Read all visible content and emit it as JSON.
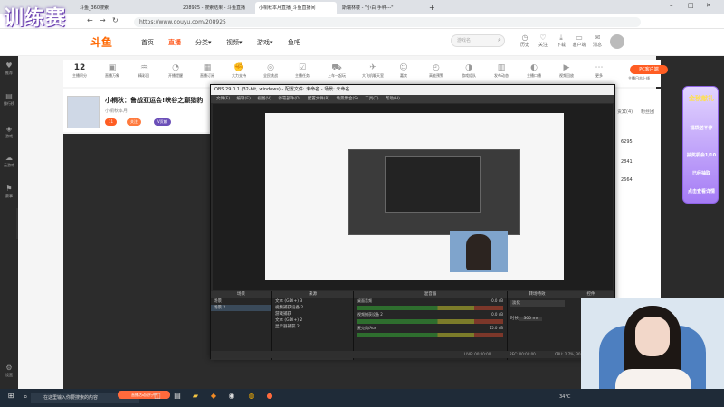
{
  "browser": {
    "tabs": [
      {
        "label": "斗鱼_360搜索",
        "active": false
      },
      {
        "label": "208925 - 搜索结果 - 斗鱼直播",
        "active": false
      },
      {
        "label": "小桐秋本月直播_斗鱼直播间",
        "active": true
      },
      {
        "label": "斯瑞林楼 - \"小白 手秤---\"",
        "active": false
      }
    ],
    "new_tab_label": "+",
    "url": "https://www.douyu.com/208925",
    "window_controls": [
      "–",
      "□",
      "✕"
    ]
  },
  "watermark": "训练赛",
  "douyu": {
    "logo": "斗鱼",
    "nav": [
      {
        "label": "首页",
        "active": false
      },
      {
        "label": "直播",
        "active": true
      },
      {
        "label": "分类▾",
        "active": false
      },
      {
        "label": "视频▾",
        "active": false
      },
      {
        "label": "游戏▾",
        "active": false
      },
      {
        "label": "鱼吧",
        "active": false
      }
    ],
    "search_placeholder": "游戏名",
    "header_icons": [
      {
        "label": "历史",
        "icon": "history-icon",
        "glyph": "◷"
      },
      {
        "label": "关注",
        "icon": "follow-icon",
        "glyph": "♡"
      },
      {
        "label": "下载",
        "icon": "download-icon",
        "glyph": "⤓"
      },
      {
        "label": "客户端",
        "icon": "client-icon",
        "glyph": "▭"
      },
      {
        "label": "消息",
        "icon": "message-icon",
        "glyph": "✉"
      }
    ]
  },
  "sidebar": [
    {
      "label": "推荐",
      "glyph": "♥"
    },
    {
      "label": "排行榜",
      "glyph": "▤"
    },
    {
      "label": "游戏",
      "glyph": "◈"
    },
    {
      "label": "云游戏",
      "glyph": "☁"
    },
    {
      "label": "赛事",
      "glyph": "⚑"
    },
    {
      "label": "设置",
      "glyph": "⚙"
    }
  ],
  "toolbar": {
    "count": "12",
    "count_label": "主播积分",
    "items": [
      "直播万象",
      "精彩回",
      "开播提醒",
      "直播订阅",
      "大力支持",
      "全民挑战",
      "主播任务",
      "上车一起玩",
      "大飞机聊天室",
      "嘉宾",
      "高能预警",
      "游戏组队",
      "发布动态",
      "主播口播",
      "视频回放",
      "更多"
    ],
    "pc_button": "PC客户端",
    "right_note": "主播日志上线"
  },
  "room": {
    "title": "小桐秋：鲁战亚运会!峡谷之巅猎豹",
    "meta": "小桐秋本月",
    "pills": [
      "11",
      "关注",
      "V贡献"
    ]
  },
  "right_panel": {
    "tabs": [
      "贵宾(4)",
      "粉丝团"
    ],
    "rank_values": [
      "6295",
      "2841",
      "2664"
    ]
  },
  "banner": {
    "title": "金秋献礼",
    "lines": [
      "福袋送不停",
      "抽奖机会1/10",
      "已经抽取",
      "点击查看详情"
    ]
  },
  "obs": {
    "title": "OBS 29.0.1 (32-bit, windows) - 配置文件: 未命名 - 场景: 未命名",
    "menu": [
      "文件(F)",
      "编辑(E)",
      "视图(V)",
      "停靠部件(D)",
      "配置文件(P)",
      "场景集合(S)",
      "工具(T)",
      "帮助(H)"
    ],
    "docks": {
      "scenes": {
        "title": "场景",
        "items": [
          "场景",
          "场景 2"
        ]
      },
      "sources": {
        "title": "来源",
        "items": [
          "文本 (GDI+) 3",
          "视频捕获设备 2",
          "游戏捕获",
          "文本 (GDI+) 2",
          "显示器捕获 2"
        ]
      },
      "mixer": {
        "title": "混音器",
        "channels": [
          {
            "name": "桌面音频",
            "value": "-0.0 dB"
          },
          {
            "name": "视频捕获设备 2",
            "value": "0.0 dB"
          },
          {
            "name": "麦克风/Aux",
            "value": "15.0 dB"
          }
        ]
      },
      "transitions": {
        "title": "转场特效",
        "type": "淡化",
        "duration_label": "时长",
        "duration": "300 ms"
      },
      "controls": {
        "title": "控件"
      }
    },
    "status": [
      "LIVE: 00:00:00",
      "REC: 00:00:00",
      "CPU: 2.7%, 30.00 fps"
    ]
  },
  "taskbar": {
    "search_placeholder": "在这里输入你要搜索的内容",
    "weather": "34°C",
    "banner_text": "直播活动进行中"
  }
}
